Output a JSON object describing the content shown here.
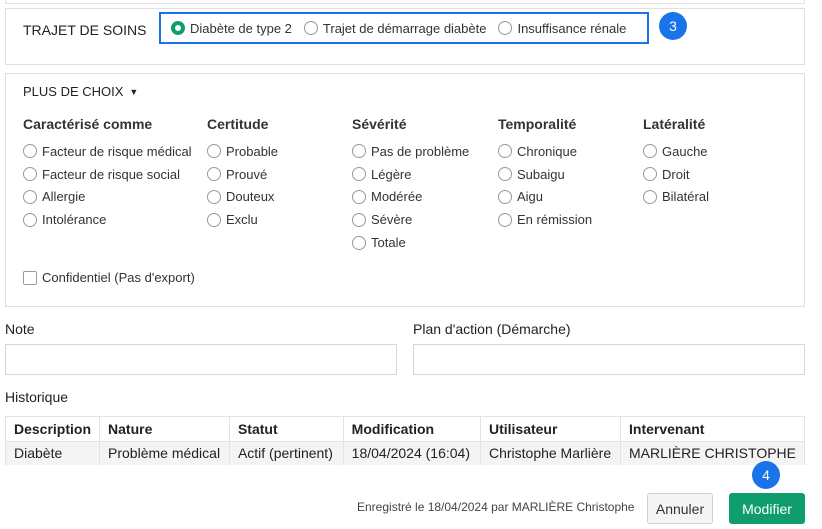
{
  "trajet": {
    "label": "TRAJET DE SOINS",
    "options": [
      {
        "label": "Diabète de type 2",
        "selected": true
      },
      {
        "label": "Trajet de démarrage diabète",
        "selected": false
      },
      {
        "label": "Insuffisance rénale",
        "selected": false
      }
    ],
    "step_badge": "3"
  },
  "more_choices": {
    "header": "PLUS DE CHOIX",
    "columns": [
      {
        "title": "Caractérisé comme",
        "options": [
          "Facteur de risque médical",
          "Facteur de risque social",
          "Allergie",
          "Intolérance"
        ]
      },
      {
        "title": "Certitude",
        "options": [
          "Probable",
          "Prouvé",
          "Douteux",
          "Exclu"
        ]
      },
      {
        "title": "Sévérité",
        "options": [
          "Pas de problème",
          "Légère",
          "Modérée",
          "Sévère",
          "Totale"
        ]
      },
      {
        "title": "Temporalité",
        "options": [
          "Chronique",
          "Subaigu",
          "Aigu",
          "En rémission"
        ]
      },
      {
        "title": "Latéralité",
        "options": [
          "Gauche",
          "Droit",
          "Bilatéral"
        ]
      }
    ],
    "confidential_label": "Confidentiel (Pas d'export)"
  },
  "note": {
    "label": "Note",
    "value": ""
  },
  "plan": {
    "label": "Plan d'action (Démarche)",
    "value": ""
  },
  "history": {
    "label": "Historique",
    "headers": [
      "Description",
      "Nature",
      "Statut",
      "Modification",
      "Utilisateur",
      "Intervenant"
    ],
    "rows": [
      [
        "Diabète",
        "Problème médical",
        "Actif (pertinent)",
        "18/04/2024 (16:04)",
        "Christophe Marlière",
        "MARLIÈRE CHRISTOPHE"
      ]
    ]
  },
  "footer": {
    "saved_text": "Enregistré le 18/04/2024 par MARLIÈRE Christophe",
    "cancel_label": "Annuler",
    "modify_label": "Modifier",
    "step_badge": "4"
  },
  "colors": {
    "accent_blue": "#1a73e8",
    "primary_green": "#0f9d6b"
  }
}
